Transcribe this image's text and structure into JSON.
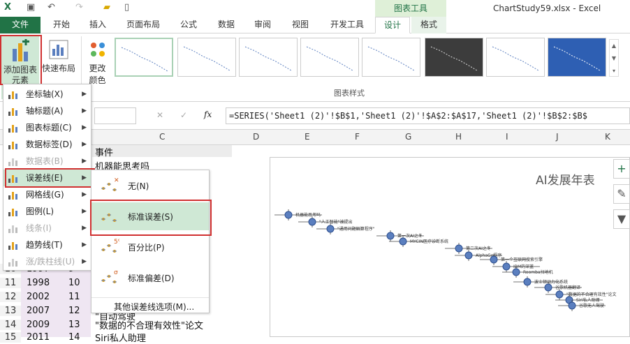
{
  "titlebar": {
    "context_group": "图表工具",
    "window_title": "ChartStudy59.xlsx - Excel"
  },
  "tabs": [
    {
      "label": "文件"
    },
    {
      "label": "开始"
    },
    {
      "label": "插入"
    },
    {
      "label": "页面布局"
    },
    {
      "label": "公式"
    },
    {
      "label": "数据"
    },
    {
      "label": "审阅"
    },
    {
      "label": "视图"
    },
    {
      "label": "开发工具"
    },
    {
      "label": "设计"
    },
    {
      "label": "格式"
    }
  ],
  "ribbon": {
    "add_element": "添加图表元素",
    "add_element_line1": "添加图表",
    "add_element_line2": "元素",
    "quick_layout": "快速布局",
    "change_colors_line1": "更改",
    "change_colors_line2": "颜色",
    "gallery_label": "图表样式"
  },
  "formula_bar": {
    "fx": "fx",
    "formula": "=SERIES('Sheet1 (2)'!$B$1,'Sheet1 (2)'!$A$2:$A$17,'Sheet1 (2)'!$B$2:$B$"
  },
  "columns": [
    "C",
    "D",
    "E",
    "F",
    "G",
    "H",
    "I",
    "J",
    "K"
  ],
  "cells": {
    "c1": "事件",
    "c2": "机器能思考吗",
    "rows": [
      {
        "num": "10",
        "a": "1997",
        "b": "9"
      },
      {
        "num": "11",
        "a": "1998",
        "b": "10"
      },
      {
        "num": "12",
        "a": "2002",
        "b": "11"
      },
      {
        "num": "13",
        "a": "2007",
        "b": "12"
      },
      {
        "num": "14",
        "a": "2009",
        "b": "13"
      },
      {
        "num": "15",
        "a": "2011",
        "b": "14"
      }
    ],
    "c13": "\"自动驾驶",
    "c14": "\"数据的不合理有效性\"论文",
    "c15": "Siri私人助理"
  },
  "menu": [
    {
      "label": "坐标轴(X)",
      "arrow": true,
      "disabled": false
    },
    {
      "label": "轴标题(A)",
      "arrow": true,
      "disabled": false
    },
    {
      "label": "图表标题(C)",
      "arrow": true,
      "disabled": false
    },
    {
      "label": "数据标签(D)",
      "arrow": true,
      "disabled": false
    },
    {
      "label": "数据表(B)",
      "arrow": true,
      "disabled": true
    },
    {
      "label": "误差线(E)",
      "arrow": true,
      "disabled": false
    },
    {
      "label": "网格线(G)",
      "arrow": true,
      "disabled": false
    },
    {
      "label": "图例(L)",
      "arrow": true,
      "disabled": false
    },
    {
      "label": "线条(I)",
      "arrow": true,
      "disabled": true
    },
    {
      "label": "趋势线(T)",
      "arrow": true,
      "disabled": false
    },
    {
      "label": "涨/跌柱线(U)",
      "arrow": true,
      "disabled": true
    }
  ],
  "submenu": [
    {
      "label": "无(N)",
      "badge": "✕"
    },
    {
      "label": "标准误差(S)",
      "badge": ""
    },
    {
      "label": "百分比(P)",
      "badge": "5%"
    },
    {
      "label": "标准偏差(D)",
      "badge": "σ"
    }
  ],
  "submenu_more": "其他误差线选项(M)...",
  "chart": {
    "title": "AI发展年表",
    "labels": [
      "机器能思考吗",
      "\"人工智能\"被提出",
      "\"通用问题解算程序\"",
      "第一次AI之冬",
      "MYCIN医疗诊断系统",
      "第二次AI之冬",
      "AlphaGo程序",
      "第一个互联网搜索引擎",
      "IBM的深蓝",
      "Roomba扫地机",
      "波士顿动力化系统",
      "谷歌机器翻译",
      "\"数据的不合理有效性\"论文",
      "Siri私人助理",
      "谷歌无人驾驶"
    ]
  },
  "colors": {
    "excel_green": "#217346",
    "highlight_red": "#d03030",
    "selection_fill": "#cfe8d5",
    "marker_blue": "#5b7fbf"
  }
}
